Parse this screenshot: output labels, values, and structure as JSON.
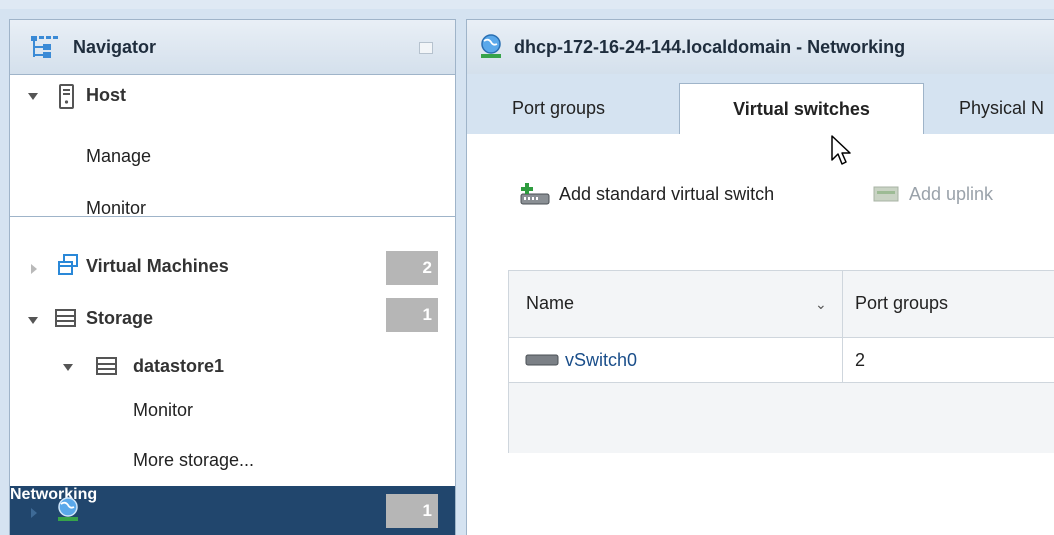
{
  "navigator": {
    "title": "Navigator",
    "host": {
      "label": "Host",
      "children": [
        "Manage",
        "Monitor"
      ]
    },
    "virtual_machines": {
      "label": "Virtual Machines",
      "count": "2"
    },
    "storage": {
      "label": "Storage",
      "count": "1",
      "datastore": {
        "label": "datastore1",
        "children": [
          "Monitor",
          "More storage..."
        ]
      }
    },
    "networking": {
      "label": "Networking",
      "count": "1"
    }
  },
  "main": {
    "title": "dhcp-172-16-24-144.localdomain - Networking",
    "tabs": [
      {
        "label": "Port groups",
        "active": false
      },
      {
        "label": "Virtual switches",
        "active": true
      },
      {
        "label": "Physical N",
        "active": false
      }
    ],
    "toolbar": {
      "add_switch": "Add standard virtual switch",
      "add_uplink": "Add uplink"
    },
    "table": {
      "columns": [
        "Name",
        "Port groups"
      ],
      "rows": [
        {
          "name": "vSwitch0",
          "port_groups": "2"
        }
      ]
    }
  },
  "colors": {
    "selected_bg": "#21466d",
    "badge_bg": "#b6b6b6",
    "link": "#1a4e8a",
    "frame_bg": "#d5e3f1"
  }
}
